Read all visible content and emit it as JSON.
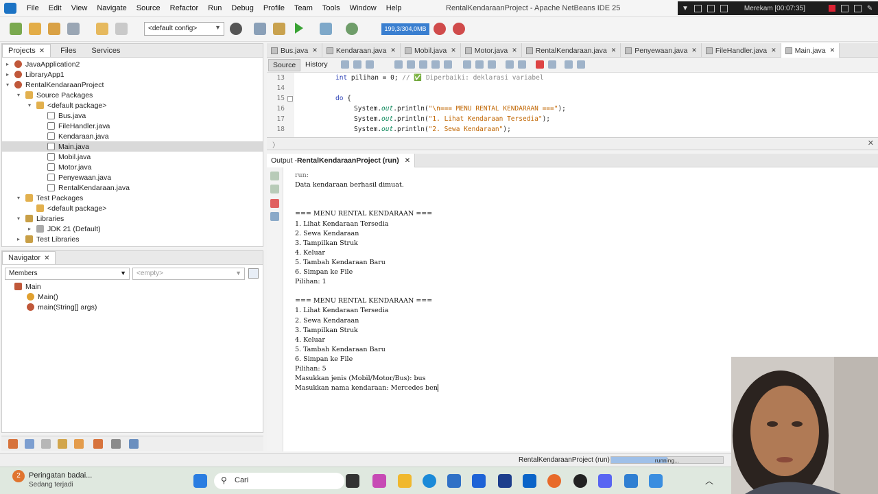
{
  "window": {
    "title": "RentalKendaraanProject - Apache NetBeans IDE 25"
  },
  "menu": [
    "File",
    "Edit",
    "View",
    "Navigate",
    "Source",
    "Refactor",
    "Run",
    "Debug",
    "Profile",
    "Team",
    "Tools",
    "Window",
    "Help"
  ],
  "recorder": {
    "label": "Merekam [00:07:35]"
  },
  "toolbar": {
    "config": "<default config>",
    "memory": "199,3/304,0MB"
  },
  "projects": {
    "tabs": [
      "Projects",
      "Files",
      "Services"
    ],
    "tree": [
      {
        "label": "JavaApplication2",
        "indent": 0,
        "icon": "project-icon",
        "twisty": "▸"
      },
      {
        "label": "LibraryApp1",
        "indent": 0,
        "icon": "project-icon",
        "twisty": "▸"
      },
      {
        "label": "RentalKendaraanProject",
        "indent": 0,
        "icon": "project-icon",
        "twisty": "▾"
      },
      {
        "label": "Source Packages",
        "indent": 1,
        "icon": "package-folder-icon",
        "twisty": "▾"
      },
      {
        "label": "<default package>",
        "indent": 2,
        "icon": "package-icon",
        "twisty": "▾"
      },
      {
        "label": "Bus.java",
        "indent": 3,
        "icon": "java-file-icon",
        "twisty": ""
      },
      {
        "label": "FileHandler.java",
        "indent": 3,
        "icon": "java-file-icon",
        "twisty": ""
      },
      {
        "label": "Kendaraan.java",
        "indent": 3,
        "icon": "java-file-icon",
        "twisty": ""
      },
      {
        "label": "Main.java",
        "indent": 3,
        "icon": "java-file-icon",
        "twisty": "",
        "selected": true
      },
      {
        "label": "Mobil.java",
        "indent": 3,
        "icon": "java-file-icon",
        "twisty": ""
      },
      {
        "label": "Motor.java",
        "indent": 3,
        "icon": "java-file-icon",
        "twisty": ""
      },
      {
        "label": "Penyewaan.java",
        "indent": 3,
        "icon": "java-file-icon",
        "twisty": ""
      },
      {
        "label": "RentalKendaraan.java",
        "indent": 3,
        "icon": "java-file-icon",
        "twisty": ""
      },
      {
        "label": "Test Packages",
        "indent": 1,
        "icon": "package-folder-icon",
        "twisty": "▾"
      },
      {
        "label": "<default package>",
        "indent": 2,
        "icon": "package-icon",
        "twisty": ""
      },
      {
        "label": "Libraries",
        "indent": 1,
        "icon": "library-icon",
        "twisty": "▾"
      },
      {
        "label": "JDK 21 (Default)",
        "indent": 2,
        "icon": "jdk-icon",
        "twisty": "▸"
      },
      {
        "label": "Test Libraries",
        "indent": 1,
        "icon": "library-icon",
        "twisty": "▸"
      }
    ]
  },
  "navigator": {
    "title": "Navigator",
    "filter": "Members",
    "filter2": "<empty>",
    "items": [
      {
        "label": "Main",
        "indent": 0,
        "color": "#c0583a"
      },
      {
        "label": "Main()",
        "indent": 1,
        "color": "#e0a030"
      },
      {
        "label": "main(String[] args)",
        "indent": 1,
        "color": "#c0583a"
      }
    ]
  },
  "editor": {
    "tabs": [
      "Bus.java",
      "Kendaraan.java",
      "Mobil.java",
      "Motor.java",
      "RentalKendaraan.java",
      "Penyewaan.java",
      "FileHandler.java",
      "Main.java"
    ],
    "active_tab": "Main.java",
    "subtabs": [
      "Source",
      "History"
    ],
    "lines": [
      {
        "num": "13",
        "indent": 0,
        "parts": [
          {
            "t": "int",
            "c": "kw"
          },
          {
            "t": " pilihan = 0; ",
            "c": ""
          },
          {
            "t": "// ✅ Diperbaiki: deklarasi variabel",
            "c": "cmt"
          }
        ]
      },
      {
        "num": "14",
        "indent": 0,
        "parts": []
      },
      {
        "num": "15",
        "indent": 0,
        "parts": [
          {
            "t": "do",
            "c": "kw"
          },
          {
            "t": " {",
            "c": ""
          }
        ]
      },
      {
        "num": "16",
        "indent": 1,
        "parts": [
          {
            "t": "System.",
            "c": ""
          },
          {
            "t": "out",
            "c": "fld"
          },
          {
            "t": ".println(",
            "c": ""
          },
          {
            "t": "\"\\n=== MENU RENTAL KENDARAAN ===\"",
            "c": "str"
          },
          {
            "t": ");",
            "c": ""
          }
        ]
      },
      {
        "num": "17",
        "indent": 1,
        "parts": [
          {
            "t": "System.",
            "c": ""
          },
          {
            "t": "out",
            "c": "fld"
          },
          {
            "t": ".println(",
            "c": ""
          },
          {
            "t": "\"1. Lihat Kendaraan Tersedia\"",
            "c": "str"
          },
          {
            "t": ");",
            "c": ""
          }
        ]
      },
      {
        "num": "18",
        "indent": 1,
        "parts": [
          {
            "t": "System.",
            "c": ""
          },
          {
            "t": "out",
            "c": "fld"
          },
          {
            "t": ".println(",
            "c": ""
          },
          {
            "t": "\"2. Sewa Kendaraan\"",
            "c": "str"
          },
          {
            "t": ");",
            "c": ""
          }
        ]
      }
    ]
  },
  "output": {
    "tab_prefix": "Output - ",
    "tab_title": "RentalKendaraanProject (run)",
    "lines": [
      "run:",
      "Data kendaraan berhasil dimuat.",
      "",
      "",
      "=== MENU RENTAL KENDARAAN ===",
      "1. Lihat Kendaraan Tersedia",
      "2. Sewa Kendaraan",
      "3. Tampilkan Struk",
      "4. Keluar",
      "5. Tambah Kendaraan Baru",
      "6. Simpan ke File",
      "Pilihan: 1",
      "",
      "=== MENU RENTAL KENDARAAN ===",
      "1. Lihat Kendaraan Tersedia",
      "2. Sewa Kendaraan",
      "3. Tampilkan Struk",
      "4. Keluar",
      "5. Tambah Kendaraan Baru",
      "6. Simpan ke File",
      "Pilihan: 5",
      "Masukkan jenis (Mobil/Motor/Bus): bus",
      "Masukkan nama kendaraan: Mercedes ben"
    ]
  },
  "status": {
    "project": "RentalKendaraanProject (run)",
    "progress_label": "running...",
    "progress_fraction": 0.5
  },
  "taskbar": {
    "notification_title": "Peringatan badai...",
    "notification_sub": "Sedang terjadi",
    "notification_count": "2",
    "search": "Cari"
  }
}
